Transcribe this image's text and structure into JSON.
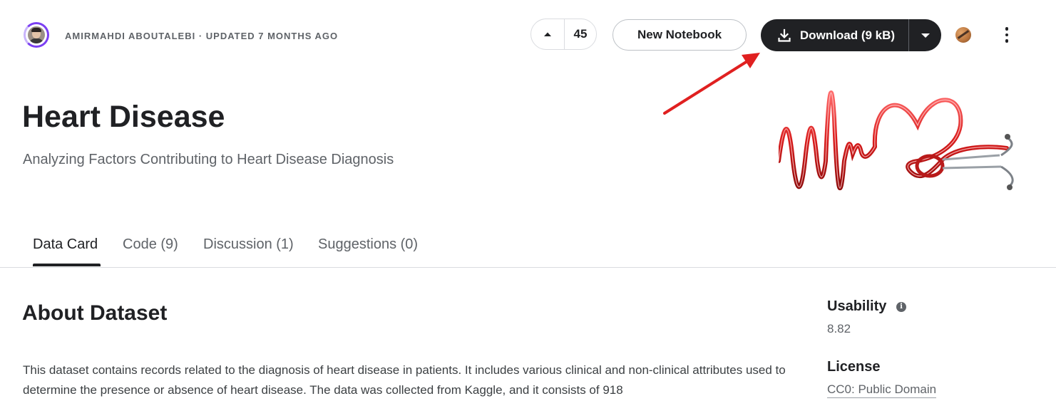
{
  "header": {
    "byline": "AMIRMAHDI ABOUTALEBI · UPDATED 7 MONTHS AGO",
    "vote_count": "45",
    "new_notebook_label": "New Notebook",
    "download_label": "Download (9 kB)"
  },
  "dataset": {
    "title": "Heart Disease",
    "subtitle": "Analyzing Factors Contributing to Heart Disease Diagnosis"
  },
  "tabs": [
    {
      "label": "Data Card",
      "active": true
    },
    {
      "label": "Code (9)",
      "active": false
    },
    {
      "label": "Discussion (1)",
      "active": false
    },
    {
      "label": "Suggestions (0)",
      "active": false
    }
  ],
  "about": {
    "heading": "About Dataset",
    "description": "This dataset contains records related to the diagnosis of heart disease in patients. It includes various clinical and non-clinical attributes used to determine the presence or absence of heart disease. The data was collected from Kaggle, and it consists of 918"
  },
  "sidebar": {
    "usability_label": "Usability",
    "usability_value": "8.82",
    "license_label": "License",
    "license_value": "CC0: Public Domain"
  },
  "colors": {
    "primary_button": "#202124",
    "annotation_arrow": "#e02020",
    "avatar_ring": "#7b3ff2"
  },
  "icons": [
    "avatar",
    "upvote-icon",
    "download-icon",
    "chevron-down-icon",
    "user-menu-icon",
    "more-vert-icon",
    "info-icon",
    "annotation-arrow"
  ]
}
